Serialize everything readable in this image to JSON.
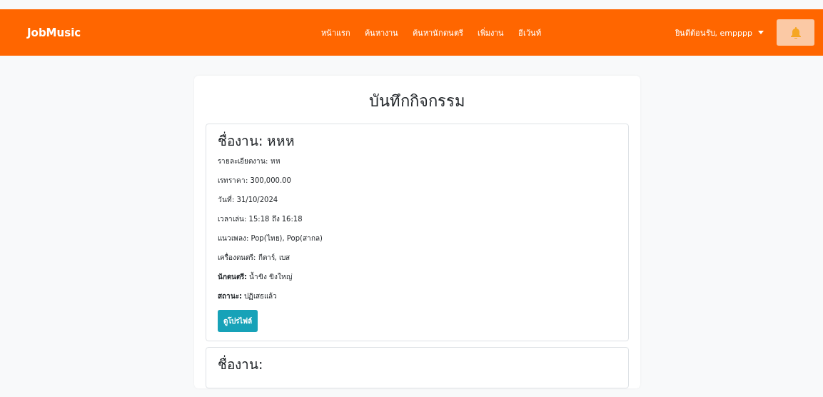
{
  "navbar": {
    "brand": "JobMusic",
    "links": [
      {
        "label": "หน้าแรก"
      },
      {
        "label": "ค้นหางาน"
      },
      {
        "label": "ค้นหานักดนตรี"
      },
      {
        "label": "เพิ่มงาน"
      },
      {
        "label": "อีเว้นท์"
      }
    ],
    "user_menu": "ยินดีต้อนรับ, empppp"
  },
  "page_title": "บันทึกกิจกรรม",
  "jobs": [
    {
      "title": "ชื่องาน: หหห",
      "details": [
        {
          "text": "รายละเอียดงาน: หห"
        },
        {
          "text": "เรทราคา: 300,000.00"
        },
        {
          "text": "วันที่: 31/10/2024"
        },
        {
          "text": "เวลาเล่น: 15:18 ถึง 16:18"
        },
        {
          "text": "แนวเพลง: Pop(ไทย), Pop(สากล)"
        },
        {
          "text": "เครื่องดนตรี: กีตาร์, เบส"
        },
        {
          "text": "**นักดนตรี:** น้ำขิง  ขิงใหญ่"
        },
        {
          "text": "**สถานะ:** ปฏิเสธแล้ว"
        }
      ],
      "button": "ดูโปรไฟล์"
    },
    {
      "title": "ชื่องาน:"
    }
  ]
}
